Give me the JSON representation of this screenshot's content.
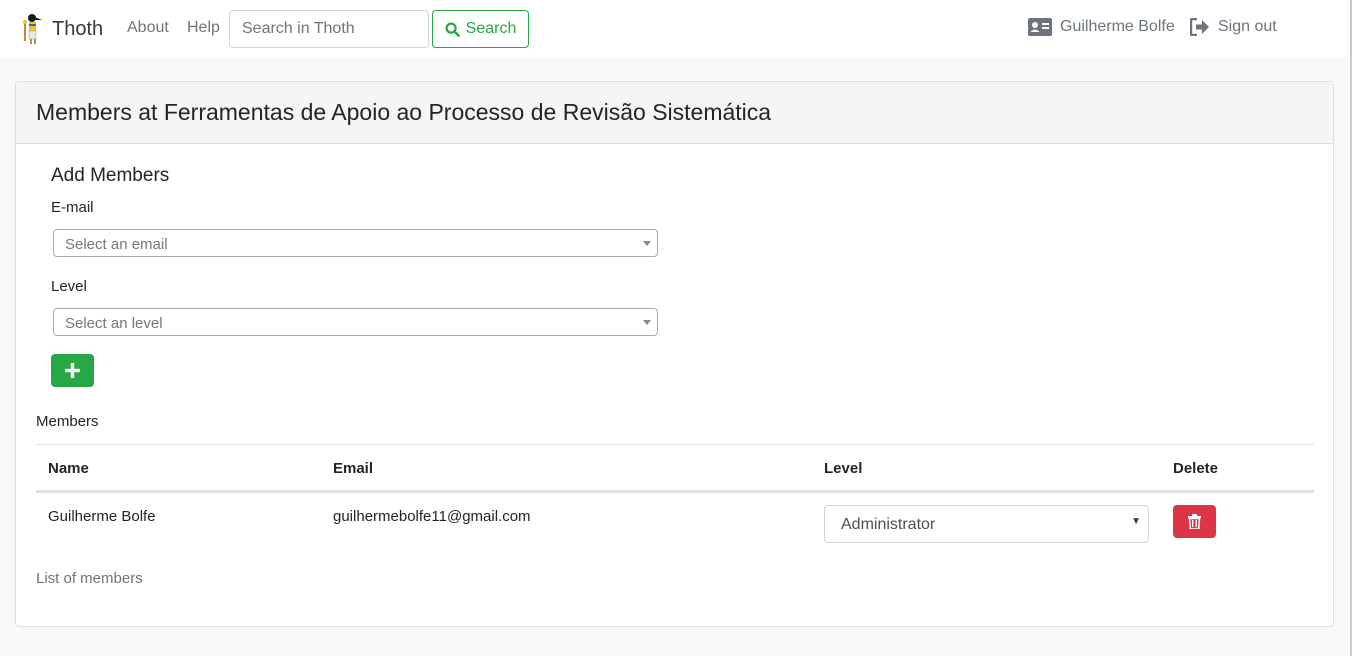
{
  "navbar": {
    "brand": "Thoth",
    "links": [
      {
        "label": "About"
      },
      {
        "label": "Help"
      }
    ],
    "search": {
      "placeholder": "Search in Thoth",
      "value": "",
      "button_label": "Search"
    },
    "user": {
      "name": "Guilherme Bolfe",
      "signout_label": "Sign out"
    }
  },
  "card": {
    "title": "Members at Ferramentas de Apoio ao Processo de Revisão Sistemática",
    "add_members": {
      "title": "Add Members",
      "email_label": "E-mail",
      "email_placeholder": "Select an email",
      "level_label": "Level",
      "level_placeholder": "Select an level"
    },
    "members": {
      "title": "Members",
      "columns": [
        "Name",
        "Email",
        "Level",
        "Delete"
      ],
      "rows": [
        {
          "name": "Guilherme Bolfe",
          "email": "guilhermebolfe11@gmail.com",
          "level": "Administrator"
        }
      ],
      "caption": "List of members"
    }
  },
  "colors": {
    "success": "#28a745",
    "danger": "#dc3545",
    "muted": "#6c757d"
  },
  "icons": {
    "brand": "thoth-logo-icon",
    "search": "search-icon",
    "user": "id-card-icon",
    "signout": "sign-out-icon",
    "add": "plus-icon",
    "delete": "trash-icon"
  }
}
